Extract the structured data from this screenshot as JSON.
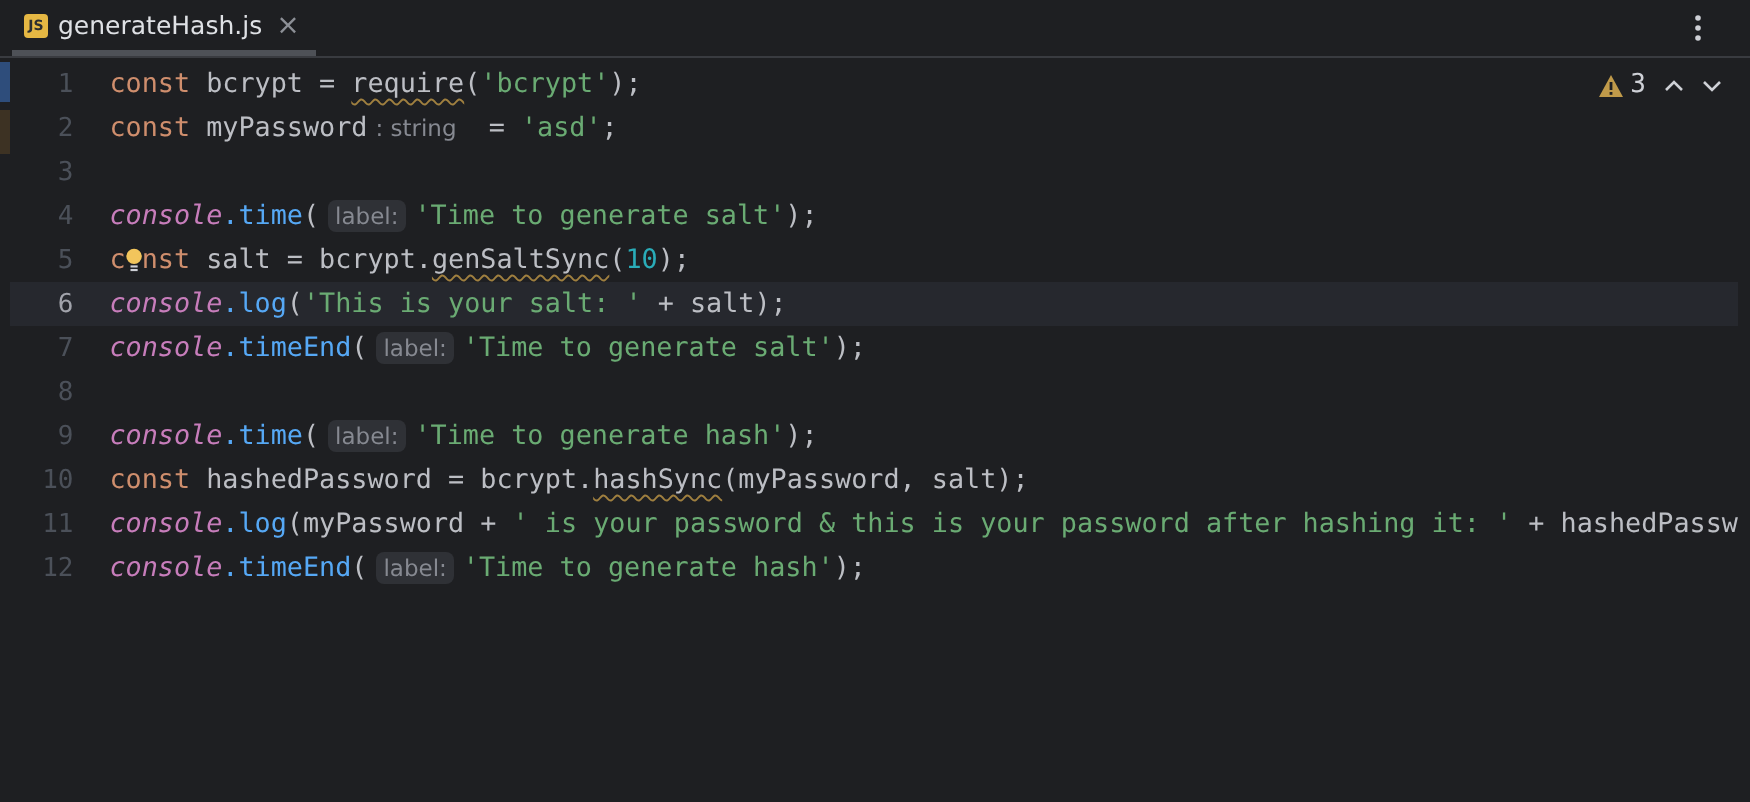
{
  "tabs": [
    {
      "label": "generateHash.js",
      "icon_text": "JS",
      "close": "×",
      "selected": true
    }
  ],
  "inspections": {
    "warnings": "3"
  },
  "lines": [
    {
      "number": "1",
      "current": false,
      "tokens": [
        {
          "kind": "keyword",
          "text": "const "
        },
        {
          "kind": "plain",
          "text": "bcrypt = "
        },
        {
          "kind": "plain",
          "text": "require",
          "warn": true
        },
        {
          "kind": "plain",
          "text": "("
        },
        {
          "kind": "string",
          "text": "'bcrypt'"
        },
        {
          "kind": "plain",
          "text": ");"
        }
      ]
    },
    {
      "number": "2",
      "current": false,
      "tokens": [
        {
          "kind": "keyword",
          "text": "const "
        },
        {
          "kind": "plain",
          "text": "myPassword"
        },
        {
          "kind": "type_hint",
          "text": ": string"
        },
        {
          "kind": "plain",
          "text": " = "
        },
        {
          "kind": "string",
          "text": "'asd'"
        },
        {
          "kind": "plain",
          "text": ";"
        }
      ]
    },
    {
      "number": "3",
      "current": false
    },
    {
      "number": "4",
      "current": false,
      "tokens": [
        {
          "kind": "object",
          "text": "console"
        },
        {
          "kind": "method",
          "text": ".time"
        },
        {
          "kind": "plain",
          "text": "("
        },
        {
          "kind": "param_hint",
          "text": "label:"
        },
        {
          "kind": "string",
          "text": "'Time to generate salt'"
        },
        {
          "kind": "plain",
          "text": ");"
        }
      ]
    },
    {
      "number": "5",
      "current": false,
      "tokens": [
        {
          "kind": "keyword",
          "text": "c"
        },
        {
          "kind": "bulb"
        },
        {
          "kind": "keyword",
          "text": "nst "
        },
        {
          "kind": "plain",
          "text": "salt = bcrypt."
        },
        {
          "kind": "plain",
          "text": "genSaltSync",
          "warn": true
        },
        {
          "kind": "plain",
          "text": "("
        },
        {
          "kind": "number",
          "text": "10"
        },
        {
          "kind": "plain",
          "text": ");"
        }
      ]
    },
    {
      "number": "6",
      "current": true,
      "tokens": [
        {
          "kind": "object",
          "text": "console"
        },
        {
          "kind": "method",
          "text": ".log"
        },
        {
          "kind": "plain",
          "text": "("
        },
        {
          "kind": "string",
          "text": "'This is your salt: '"
        },
        {
          "kind": "plain",
          "text": " + salt);"
        }
      ]
    },
    {
      "number": "7",
      "current": false,
      "tokens": [
        {
          "kind": "object",
          "text": "console"
        },
        {
          "kind": "method",
          "text": ".timeEnd"
        },
        {
          "kind": "plain",
          "text": "("
        },
        {
          "kind": "param_hint",
          "text": "label:"
        },
        {
          "kind": "string",
          "text": "'Time to generate salt'"
        },
        {
          "kind": "plain",
          "text": ");"
        }
      ]
    },
    {
      "number": "8",
      "current": false
    },
    {
      "number": "9",
      "current": false,
      "tokens": [
        {
          "kind": "object",
          "text": "console"
        },
        {
          "kind": "method",
          "text": ".time"
        },
        {
          "kind": "plain",
          "text": "("
        },
        {
          "kind": "param_hint",
          "text": "label:"
        },
        {
          "kind": "string",
          "text": "'Time to generate hash'"
        },
        {
          "kind": "plain",
          "text": ");"
        }
      ]
    },
    {
      "number": "10",
      "current": false,
      "tokens": [
        {
          "kind": "keyword",
          "text": "const "
        },
        {
          "kind": "plain",
          "text": "hashedPassword = bcrypt."
        },
        {
          "kind": "plain",
          "text": "hashSync",
          "warn": true
        },
        {
          "kind": "plain",
          "text": "(myPassword, salt);"
        }
      ]
    },
    {
      "number": "11",
      "current": false,
      "tokens": [
        {
          "kind": "object",
          "text": "console"
        },
        {
          "kind": "method",
          "text": ".log"
        },
        {
          "kind": "plain",
          "text": "(myPassword + "
        },
        {
          "kind": "string",
          "text": "' is your password & this is your password after hashing it: '"
        },
        {
          "kind": "plain",
          "text": " + hashedPassw"
        }
      ]
    },
    {
      "number": "12",
      "current": false,
      "tokens": [
        {
          "kind": "object",
          "text": "console"
        },
        {
          "kind": "method",
          "text": ".timeEnd"
        },
        {
          "kind": "plain",
          "text": "("
        },
        {
          "kind": "param_hint",
          "text": "label:"
        },
        {
          "kind": "string",
          "text": "'Time to generate hash'"
        },
        {
          "kind": "plain",
          "text": ");"
        }
      ]
    }
  ]
}
